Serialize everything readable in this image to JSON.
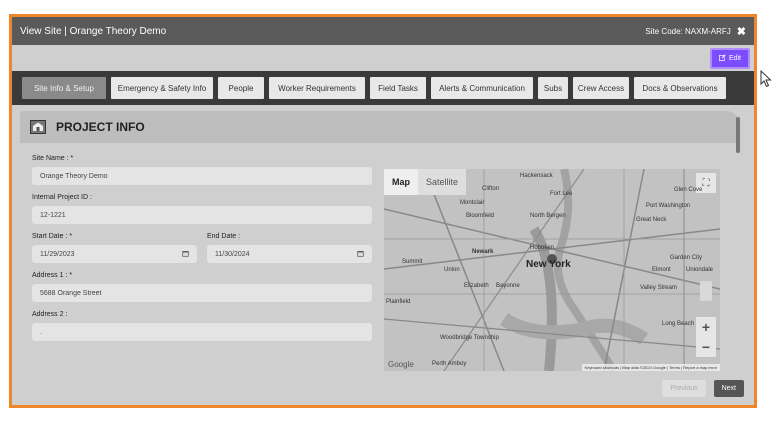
{
  "window": {
    "title": "View Site | Orange Theory Demo",
    "site_code": "Site Code: NAXM-ARFJ",
    "close_glyph": "✖"
  },
  "actions": {
    "edit_label": "Edit"
  },
  "tabs": [
    {
      "label": "Site Info & Setup",
      "active": true
    },
    {
      "label": "Emergency & Safety Info"
    },
    {
      "label": "People"
    },
    {
      "label": "Worker Requirements"
    },
    {
      "label": "Field Tasks"
    },
    {
      "label": "Alerts & Communication"
    },
    {
      "label": "Subs"
    },
    {
      "label": "Crew Access"
    },
    {
      "label": "Docs & Observations"
    }
  ],
  "section": {
    "title": "PROJECT INFO"
  },
  "form": {
    "site_name_label": "Site Name : *",
    "site_name_value": "Orange Theory Demo",
    "internal_id_label": "Internal Project ID :",
    "internal_id_value": "12-1221",
    "start_date_label": "Start Date : *",
    "start_date_value": "11/29/2023",
    "end_date_label": "End Date :",
    "end_date_value": "11/30/2024",
    "address1_label": "Address 1 : *",
    "address1_value": "5688 Orange Street",
    "address2_label": "Address 2 :",
    "address2_value": "."
  },
  "map": {
    "map_label": "Map",
    "satellite_label": "Satellite",
    "zoom_in": "+",
    "zoom_out": "−",
    "google": "Google",
    "attribution": "Keyboard shortcuts  |  Map data ©2024 Google  |  Terms  |  Report a map error",
    "cities": {
      "newark": "Newark",
      "new_york": "New York",
      "hoboken": "Hoboken",
      "union": "Union",
      "elizabeth": "Elizabeth",
      "bayonne": "Bayonne",
      "clifton": "Clifton",
      "montclair": "Montclair",
      "bloomfield": "Bloomfield",
      "hackensack": "Hackensack",
      "fort_lee": "Fort Lee",
      "north_bergen": "North Bergen",
      "glen_cove": "Glen Cove",
      "port_washington": "Port Washington",
      "great_neck": "Great Neck",
      "summit": "Summit",
      "plainfield": "Plainfield",
      "garden_city": "Garden City",
      "elmont": "Elmont",
      "uniondale": "Uniondale",
      "valley_stream": "Valley Stream",
      "long_beach": "Long Beach",
      "woodbridge": "Woodbridge Township",
      "perth_amboy": "Perth Amboy"
    }
  },
  "footer": {
    "previous": "Previous",
    "next": "Next"
  }
}
